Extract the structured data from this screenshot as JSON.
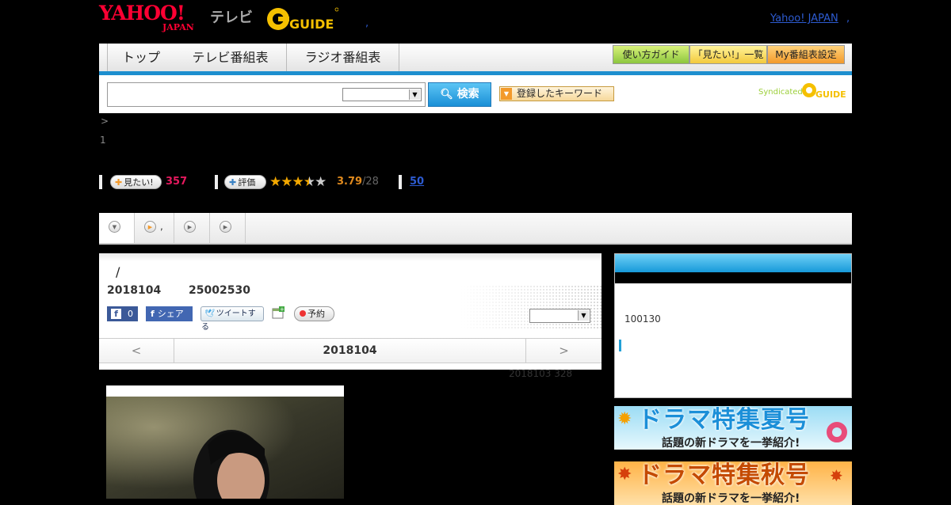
{
  "header": {
    "brand_yahoo": "YAHOO!",
    "brand_japan": "JAPAN",
    "brand_tv": "テレビ",
    "brand_guide": "G GUIDE",
    "comma_left": ",",
    "yahoo_link": "Yahoo! JAPAN",
    "comma_right": ","
  },
  "nav": {
    "tabs": [
      "トップ",
      "テレビ番組表",
      "ラジオ番組表"
    ],
    "buttons": [
      "使い方ガイド",
      "「見たい!」一覧",
      "My番組表設定"
    ]
  },
  "search": {
    "button": "検索",
    "keyword_button": "登録したキーワード",
    "syndicated": "Syndicated",
    "syndicated_logo": "GUIDE"
  },
  "breadcrumb": ">",
  "episode_number": "1",
  "stats": {
    "want_label": "見たい!",
    "want_count": "357",
    "rate_label": "評価",
    "rating": 3.79,
    "rating_text": "3.79",
    "rating_total": "/28",
    "link_count": "50"
  },
  "tabs": {
    "t2_text": ","
  },
  "program": {
    "slash": "/",
    "date": "2018104",
    "time": "25002530",
    "fb_like_count": "0",
    "fb_share": "シェア",
    "tweet": "ツイートする",
    "reserve": "予約",
    "nav_prev": "<",
    "nav_date": "2018104",
    "nav_next": ">",
    "aired_note": "2018103  328"
  },
  "sidebar": {
    "value": "100130"
  },
  "banners": {
    "summer_title": "ドラマ特集夏号",
    "summer_sub": "話題の新ドラマを一挙紹介!",
    "autumn_title": "ドラマ特集秋号",
    "autumn_sub": "話題の新ドラマを一挙紹介!"
  },
  "colors": {
    "accent_blue": "#1d8fcf",
    "stat_pink": "#e5195e",
    "stat_orange": "#e08a1e",
    "yahoo_red": "#ff0033"
  }
}
